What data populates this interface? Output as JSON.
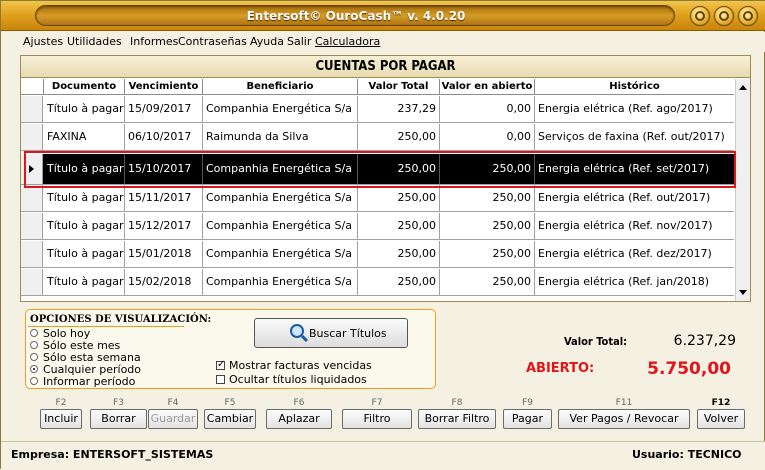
{
  "window": {
    "title": "Entersoft© OuroCash™ v. 4.0.20"
  },
  "menu": [
    {
      "label": "Ajustes",
      "underline": false
    },
    {
      "label": "Utilidades",
      "underline": false
    },
    {
      "label": "Informes",
      "underline": false
    },
    {
      "label": "Contraseñas",
      "underline": false
    },
    {
      "label": "Ayuda",
      "underline": false
    },
    {
      "label": "Salir",
      "underline": false
    },
    {
      "label": "Calculadora",
      "underline": true
    }
  ],
  "panel": {
    "title": "CUENTAS POR PAGAR"
  },
  "grid": {
    "columns": [
      "Documento",
      "Vencimiento",
      "Beneficiario",
      "Valor Total",
      "Valor en abierto",
      "Histórico"
    ],
    "rows": [
      {
        "documento": "Título à pagar",
        "vencimiento": "15/09/2017",
        "beneficiario": "Companhia Energética S/a",
        "total": "237,29",
        "abierto": "0,00",
        "historico": "Energia elétrica (Ref. ago/2017)",
        "selected": false
      },
      {
        "documento": "FAXINA",
        "vencimiento": "06/10/2017",
        "beneficiario": "Raimunda da Silva",
        "total": "250,00",
        "abierto": "0,00",
        "historico": "Serviços de faxina (Ref. out/2017)",
        "selected": false
      },
      {
        "documento": "Título à pagar",
        "vencimiento": "15/10/2017",
        "beneficiario": "Companhia Energética S/a",
        "total": "250,00",
        "abierto": "250,00",
        "historico": "Energia elétrica (Ref. set/2017)",
        "selected": true
      },
      {
        "documento": "Título à pagar",
        "vencimiento": "15/11/2017",
        "beneficiario": "Companhia Energética S/a",
        "total": "250,00",
        "abierto": "250,00",
        "historico": "Energia elétrica (Ref. out/2017)",
        "selected": false
      },
      {
        "documento": "Título à pagar",
        "vencimiento": "15/12/2017",
        "beneficiario": "Companhia Energética S/a",
        "total": "250,00",
        "abierto": "250,00",
        "historico": "Energia elétrica (Ref. nov/2017)",
        "selected": false
      },
      {
        "documento": "Título à pagar",
        "vencimiento": "15/01/2018",
        "beneficiario": "Companhia Energética S/a",
        "total": "250,00",
        "abierto": "250,00",
        "historico": "Energia elétrica (Ref. dez/2017)",
        "selected": false
      },
      {
        "documento": "Título à pagar",
        "vencimiento": "15/02/2018",
        "beneficiario": "Companhia Energética S/a",
        "total": "250,00",
        "abierto": "250,00",
        "historico": "Energia elétrica (Ref. jan/2018)",
        "selected": false
      }
    ]
  },
  "options": {
    "title": "OPCIONES DE VISUALIZACIÓN:",
    "radios": [
      {
        "label": "Solo hoy",
        "checked": false
      },
      {
        "label": "Sólo este mes",
        "checked": false
      },
      {
        "label": "Sólo esta semana",
        "checked": false
      },
      {
        "label": "Cualquier período",
        "checked": true
      },
      {
        "label": "Informar período",
        "checked": false
      }
    ],
    "search_label": "Buscar Títulos",
    "checkboxes": [
      {
        "label": "Mostrar facturas vencidas",
        "checked": true
      },
      {
        "label": "Ocultar títulos liquidados",
        "checked": false
      }
    ]
  },
  "totals": {
    "total_label": "Valor Total:",
    "total_value": "6.237,29",
    "open_label": "ABIERTO:",
    "open_value": "5.750,00",
    "open_color": "#e0151b"
  },
  "fkeys": [
    {
      "key": "F2",
      "label": "Incluir",
      "enabled": true
    },
    {
      "key": "F3",
      "label": "Borrar",
      "enabled": true
    },
    {
      "key": "F4",
      "label": "Guardar",
      "enabled": false
    },
    {
      "key": "F5",
      "label": "Cambiar",
      "enabled": true
    },
    {
      "key": "F6",
      "label": "Aplazar",
      "enabled": true
    },
    {
      "key": "F7",
      "label": "Filtro",
      "enabled": true
    },
    {
      "key": "F8",
      "label": "Borrar Filtro",
      "enabled": true
    },
    {
      "key": "F9",
      "label": "Pagar",
      "enabled": true
    },
    {
      "key": "F11",
      "label": "Ver Pagos / Revocar",
      "enabled": true
    },
    {
      "key": "F12",
      "label": "Volver",
      "enabled": true
    }
  ],
  "status": {
    "empresa": "Empresa: ENTERSOFT_SISTEMAS",
    "usuario": "Usuario: TECNICO"
  }
}
